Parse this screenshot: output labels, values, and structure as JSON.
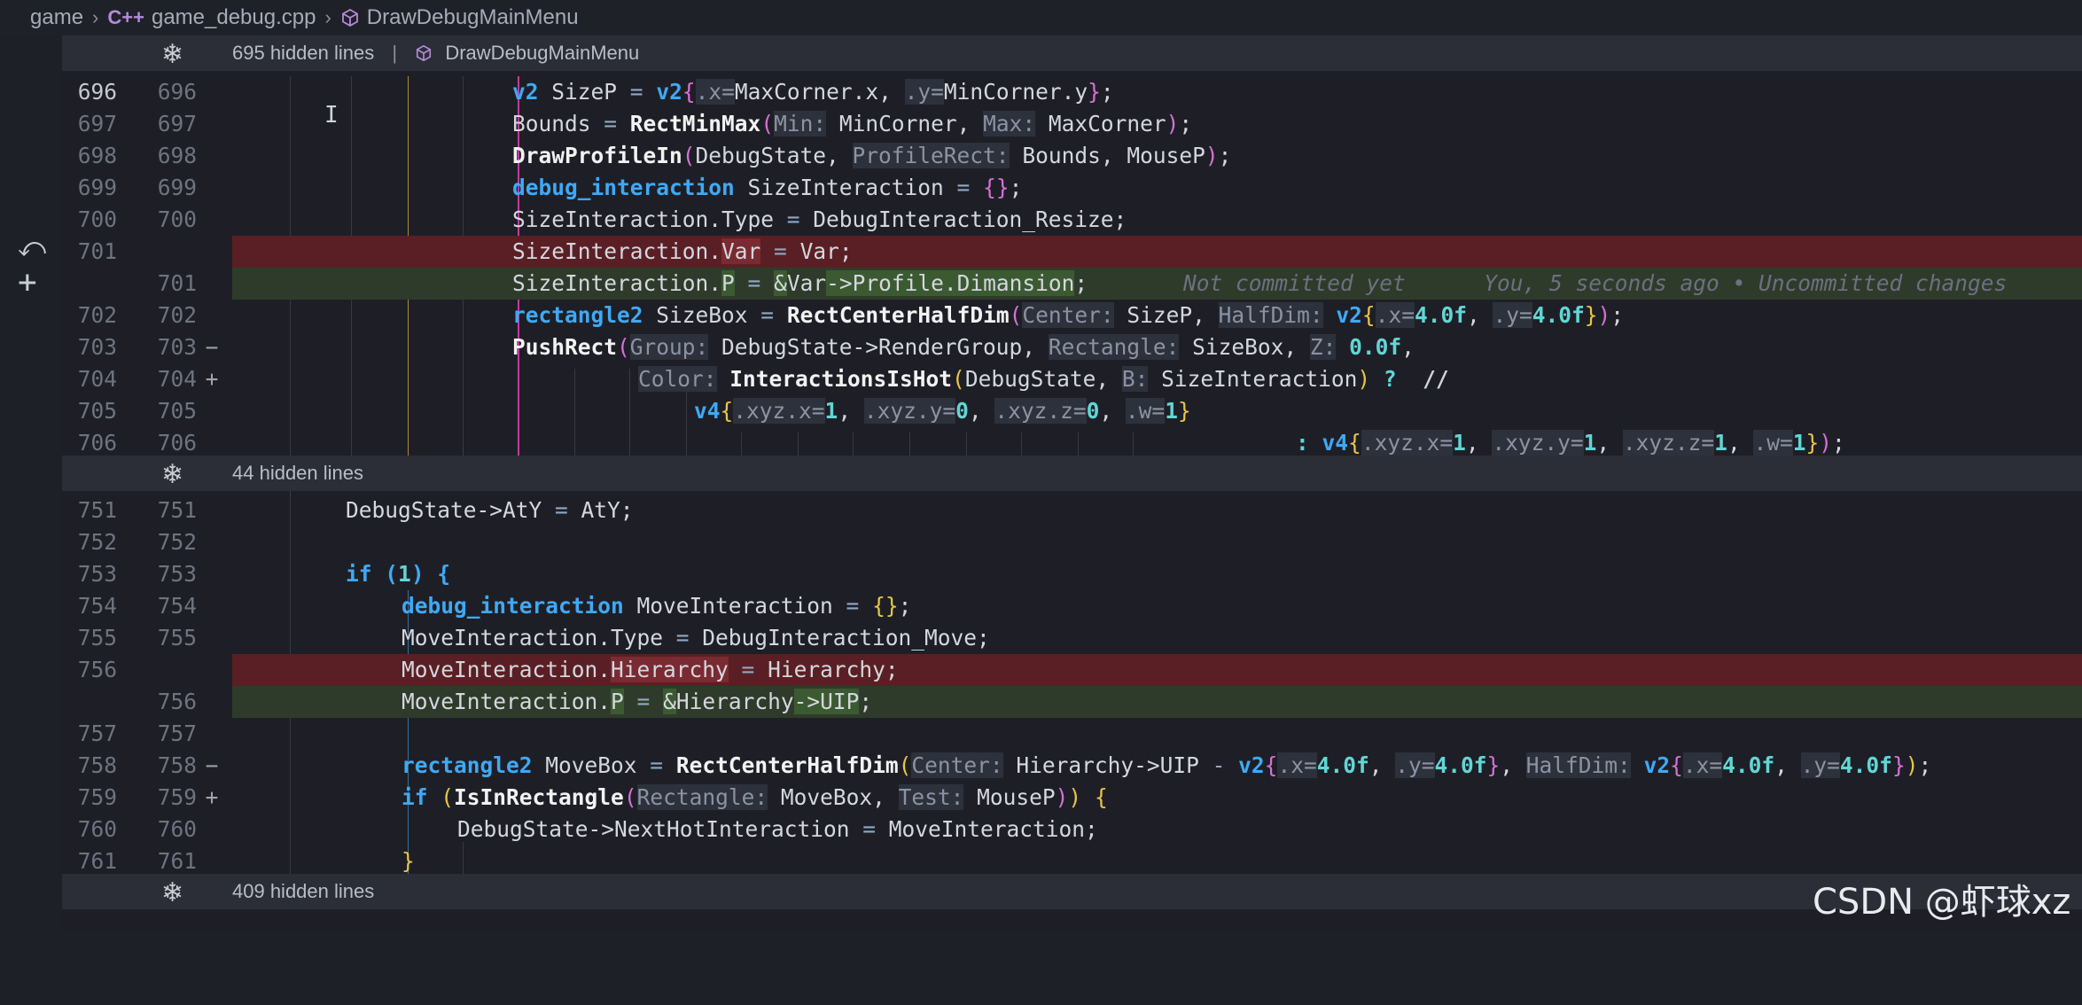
{
  "breadcrumb": {
    "folder": "game",
    "file": "game_debug.cpp",
    "file_icon": "C++",
    "symbol": "DrawDebugMainMenu"
  },
  "folds": [
    {
      "text": "695 hidden lines",
      "divider": "|",
      "symbol": "DrawDebugMainMenu"
    },
    {
      "text": "44 hidden lines"
    },
    {
      "text": "409 hidden lines"
    }
  ],
  "lines": {
    "l696": {
      "a": "696",
      "b": "696"
    },
    "l697": {
      "a": "697",
      "b": "697"
    },
    "l698": {
      "a": "698",
      "b": "698"
    },
    "l699": {
      "a": "699",
      "b": "699"
    },
    "l700": {
      "a": "700",
      "b": "700"
    },
    "l701r": {
      "a": "701",
      "mark": "−"
    },
    "l701a": {
      "b": "701",
      "mark": "+"
    },
    "l702": {
      "a": "702",
      "b": "702"
    },
    "l703": {
      "a": "703",
      "b": "703"
    },
    "l704": {
      "a": "704",
      "b": "704"
    },
    "l705": {
      "a": "705",
      "b": "705"
    },
    "l706": {
      "a": "706",
      "b": "706"
    },
    "l751": {
      "a": "751",
      "b": "751"
    },
    "l752": {
      "a": "752",
      "b": "752"
    },
    "l753": {
      "a": "753",
      "b": "753"
    },
    "l754": {
      "a": "754",
      "b": "754"
    },
    "l755": {
      "a": "755",
      "b": "755"
    },
    "l756r": {
      "a": "756",
      "mark": "−"
    },
    "l756a": {
      "b": "756",
      "mark": "+"
    },
    "l757": {
      "a": "757",
      "b": "757"
    },
    "l758": {
      "a": "758",
      "b": "758"
    },
    "l759": {
      "a": "759",
      "b": "759"
    },
    "l760": {
      "a": "760",
      "b": "760"
    },
    "l761": {
      "a": "761",
      "b": "761"
    }
  },
  "blame": "Not committed yet      You, 5 seconds ago • Uncommitted changes",
  "watermark": "CSDN @虾球xz",
  "colors": {
    "removed_bg": "#5a1f24",
    "added_bg": "#2f3b2a",
    "keyword": "#3fa9f5",
    "active_guide": "#c13aa0"
  }
}
